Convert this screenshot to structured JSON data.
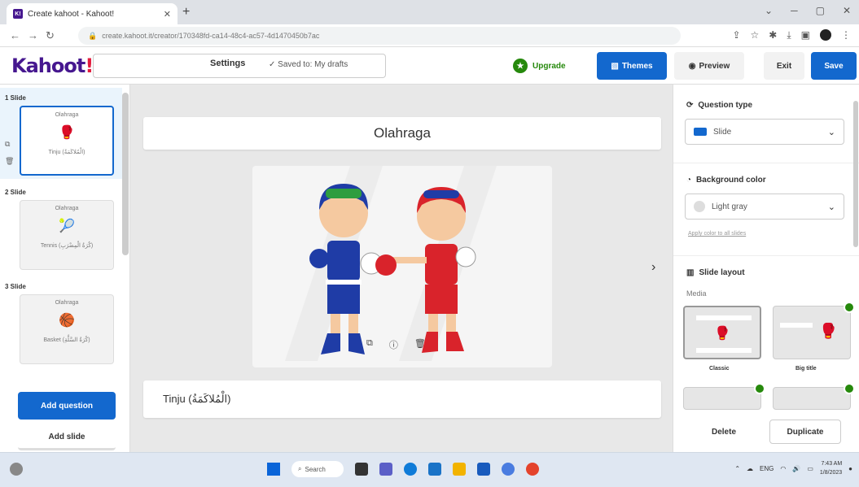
{
  "browser": {
    "tab_title": "Create kahoot - Kahoot!",
    "url": "create.kahoot.it/creator/170348fd-ca14-48c4-ac57-4d1470450b7ac"
  },
  "header": {
    "logo": "Kahoot",
    "logo_bang": "!",
    "settings_label": "Settings",
    "saved_status": "✓ Saved to: My drafts",
    "upgrade_label": "Upgrade",
    "themes_label": "Themes",
    "preview_label": "Preview",
    "exit_label": "Exit",
    "save_label": "Save"
  },
  "sidebar": {
    "slides": [
      {
        "num": "1 Slide",
        "title": "Olahraga",
        "caption": "Tinju (الْمُلاكَمَةُ)",
        "icon": "🥊"
      },
      {
        "num": "2 Slide",
        "title": "Olahraga",
        "caption": "Tennis (كُرَةُ الْمِضْرَبِ)",
        "icon": "🎾"
      },
      {
        "num": "3 Slide",
        "title": "Olahraga",
        "caption": "Basket (كُرَةُ السَّلَّةِ)",
        "icon": "🏀"
      }
    ],
    "add_question_label": "Add question",
    "add_slide_label": "Add slide"
  },
  "canvas": {
    "title": "Olahraga",
    "caption": "Tinju (الْمُلاكَمَةُ)"
  },
  "right_panel": {
    "question_type_heading": "Question type",
    "question_type_value": "Slide",
    "background_heading": "Background color",
    "background_value": "Light gray",
    "apply_all_link": "Apply color to all slides",
    "layout_heading": "Slide layout",
    "media_label": "Media",
    "layout_classic": "Classic",
    "layout_big_title": "Big title",
    "delete_label": "Delete",
    "duplicate_label": "Duplicate"
  },
  "taskbar": {
    "search_label": "Search",
    "lang": "ENG",
    "time": "7:43 AM",
    "date": "1/8/2023"
  },
  "colors": {
    "kahoot_purple": "#46178f",
    "blue_button": "#1368ce",
    "upgrade_green": "#26890c",
    "boxer_blue": "#1f3ca6",
    "boxer_red": "#d9232b"
  }
}
